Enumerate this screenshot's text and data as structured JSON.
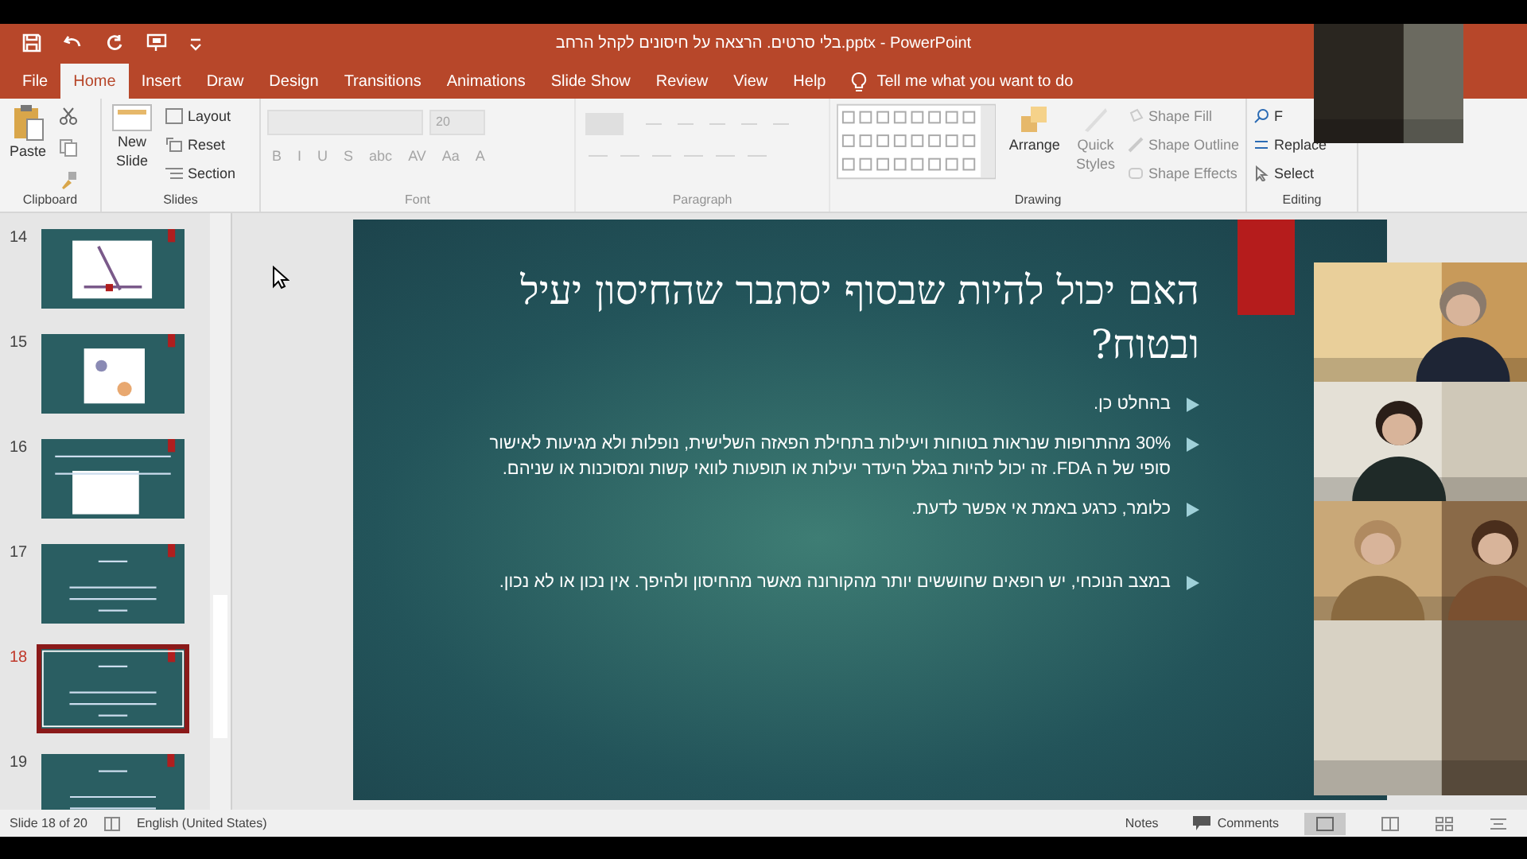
{
  "window": {
    "title": "בלי סרטים. הרצאה על חיסונים לקהל הרחב.pptx  -  PowerPoint"
  },
  "tabs": [
    {
      "label": "File",
      "selected": false
    },
    {
      "label": "Home",
      "selected": true
    },
    {
      "label": "Insert",
      "selected": false
    },
    {
      "label": "Draw",
      "selected": false
    },
    {
      "label": "Design",
      "selected": false
    },
    {
      "label": "Transitions",
      "selected": false
    },
    {
      "label": "Animations",
      "selected": false
    },
    {
      "label": "Slide Show",
      "selected": false
    },
    {
      "label": "Review",
      "selected": false
    },
    {
      "label": "View",
      "selected": false
    },
    {
      "label": "Help",
      "selected": false
    }
  ],
  "tell_me": {
    "placeholder": "Tell me what you want to do"
  },
  "ribbon": {
    "clipboard": {
      "label": "Clipboard",
      "paste": "Paste"
    },
    "slides": {
      "label": "Slides",
      "new_slide": [
        "New",
        "Slide"
      ],
      "layout": "Layout",
      "reset": "Reset",
      "section": "Section"
    },
    "font": {
      "label": "Font",
      "size": "20",
      "buttons": [
        "B",
        "I",
        "U",
        "S",
        "abc",
        "AV",
        "Aa",
        "A"
      ]
    },
    "paragraph": {
      "label": "Paragraph"
    },
    "drawing": {
      "label": "Drawing",
      "arrange": "Arrange",
      "quick_styles": [
        "Quick",
        "Styles"
      ],
      "shape_fill": "Shape Fill",
      "shape_outline": "Shape Outline",
      "shape_effects": "Shape Effects"
    },
    "editing": {
      "label": "Editing",
      "find": "F",
      "replace": "Replace",
      "select": "Select"
    }
  },
  "thumbnails": [
    {
      "number": "14",
      "kind": "diagram",
      "selected": false
    },
    {
      "number": "15",
      "kind": "figure",
      "selected": false
    },
    {
      "number": "16",
      "kind": "table",
      "selected": false
    },
    {
      "number": "17",
      "kind": "text",
      "selected": false
    },
    {
      "number": "18",
      "kind": "text",
      "selected": true
    },
    {
      "number": "19",
      "kind": "text",
      "selected": false
    }
  ],
  "slide": {
    "title": "האם יכול להיות שבסוף יסתבר שהחיסון יעיל ובטוח?",
    "bullets": [
      {
        "text": "בהחלט כן."
      },
      {
        "text": "30% מהתרופות שנראות בטוחות ויעילות בתחילת הפאזה השלישית, נופלות ולא מגיעות לאישור סופי של ה FDA. זה יכול להיות בגלל היעדר יעילות או תופעות לוואי קשות ומסוכנות או שניהם."
      },
      {
        "text": "כלומר, כרגע באמת אי אפשר לדעת."
      },
      {
        "text": "במצב הנוכחי, יש רופאים שחוששים יותר מהקורונה מאשר מהחיסון ולהיפך. אין נכון או לא נכון."
      }
    ]
  },
  "status_bar": {
    "slide_count": "Slide 18 of 20",
    "language": "English (United States)",
    "notes": "Notes",
    "comments": "Comments"
  }
}
